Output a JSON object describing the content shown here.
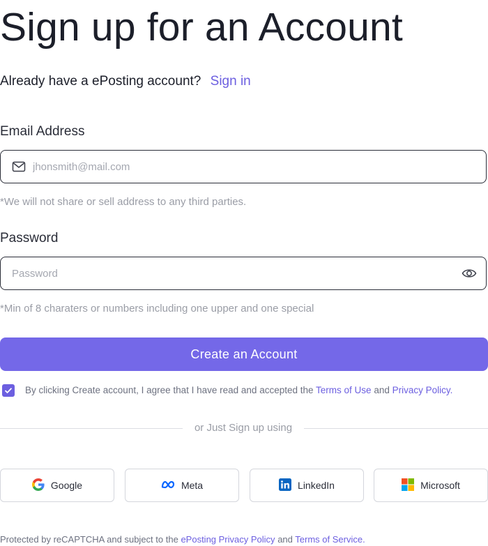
{
  "page": {
    "title": "Sign up for an Account",
    "signin_prompt": "Already have a ePosting account?",
    "signin_link": "Sign in"
  },
  "email": {
    "label": "Email Address",
    "placeholder": "jhonsmith@mail.com",
    "value": "",
    "hint": "*We will not share or sell address to any third parties.",
    "icon": "mail-icon"
  },
  "password": {
    "label": "Password",
    "placeholder": "Password",
    "value": "",
    "hint": "*Min of 8 charaters or numbers including one upper and one special",
    "icon": "eye-icon"
  },
  "cta": {
    "label": "Create an Account",
    "color": "#7468e8"
  },
  "agreement": {
    "checked": true,
    "prefix": "By clicking Create account, I agree that I have read and accepted the",
    "terms": "Terms of Use",
    "and": "and",
    "privacy": "Privacy Policy",
    "suffix": "."
  },
  "divider": {
    "text": "or Just Sign up using"
  },
  "social": [
    {
      "label": "Google",
      "icon": "google-icon"
    },
    {
      "label": "Meta",
      "icon": "meta-icon"
    },
    {
      "label": "LinkedIn",
      "icon": "linkedin-icon"
    },
    {
      "label": "Microsoft",
      "icon": "microsoft-icon"
    }
  ],
  "footer": {
    "prefix": "Protected by reCAPTCHA and subject to the",
    "privacy": "ePosting Privacy Policy",
    "and": "and",
    "terms": "Terms of Service."
  },
  "colors": {
    "accent": "#6c5fe0",
    "text": "#1c1f2a",
    "muted": "#9a9da6"
  }
}
